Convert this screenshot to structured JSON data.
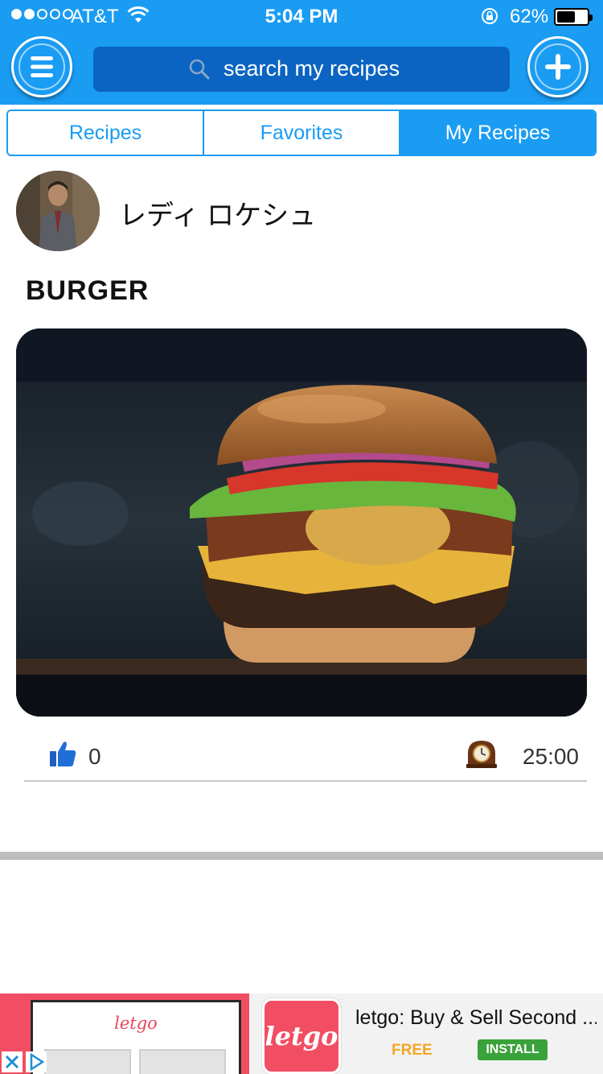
{
  "status_bar": {
    "carrier": "AT&T",
    "signal_bars_filled": 2,
    "signal_bars_total": 5,
    "time": "5:04 PM",
    "battery_percent_label": "62%",
    "battery_level": 0.62
  },
  "header": {
    "search_placeholder": "search my recipes",
    "icons": {
      "menu": "hamburger-menu-icon",
      "add": "plus-icon",
      "search": "magnifier-icon"
    },
    "accent_color": "#1a9cf3"
  },
  "tabs": [
    {
      "label": "Recipes",
      "active": false
    },
    {
      "label": "Favorites",
      "active": false
    },
    {
      "label": "My Recipes",
      "active": true
    }
  ],
  "post": {
    "author": "レディ ロケシュ",
    "title": "BURGER",
    "likes": "0",
    "duration": "25:00",
    "icons": {
      "like": "thumbs-up-icon",
      "time": "mantel-clock-icon"
    }
  },
  "ad": {
    "preview_brand": "letgo",
    "logo_text": "letgo",
    "headline": "letgo: Buy & Sell Second ...",
    "price": "FREE",
    "cta": "INSTALL",
    "brand_color": "#f24e63"
  }
}
